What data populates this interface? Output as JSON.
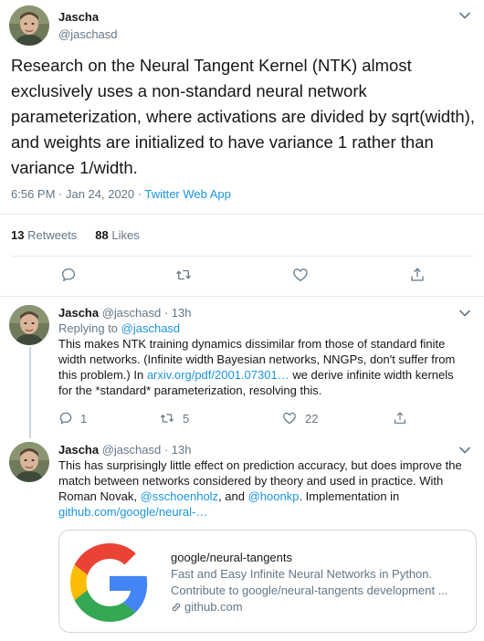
{
  "main_tweet": {
    "author_name": "Jascha",
    "author_handle": "@jaschasd",
    "text": "Research on the Neural Tangent Kernel (NTK) almost exclusively uses a non-standard neural network parameterization, where activations are divided by sqrt(width), and weights are initialized to have variance 1 rather than variance 1/width.",
    "timestamp": "6:56 PM · Jan 24, 2020 · ",
    "app": "Twitter Web App",
    "retweet_count": "13",
    "retweet_label": "Retweets",
    "like_count": "88",
    "like_label": "Likes"
  },
  "replies": [
    {
      "author_name": "Jascha",
      "author_handle": "@jaschasd",
      "time": "· 13h",
      "replying_prefix": "Replying to ",
      "replying_to": "@jaschasd",
      "text_part1": "This makes NTK training dynamics dissimilar from those of standard finite width networks. (Infinite width Bayesian networks, NNGPs, don't suffer from this problem.) In ",
      "link": "arxiv.org/pdf/2001.07301…",
      "text_part2": " we derive infinite width kernels for the *standard* parameterization, resolving this.",
      "reply_count": "1",
      "retweet_count": "5",
      "like_count": "22"
    },
    {
      "author_name": "Jascha",
      "author_handle": "@jaschasd",
      "time": "· 13h",
      "text_part1": "This has surprisingly little effect on prediction accuracy, but does improve the match between networks considered by theory and used in practice. With Roman Novak, ",
      "mention1": "@sschoenholz",
      "text_part2": ", and ",
      "mention2": "@hoonkp",
      "text_part3": ". Implementation in ",
      "link": "github.com/google/neural-…"
    }
  ],
  "link_card": {
    "title": "google/neural-tangents",
    "description_line1": "Fast and Easy Infinite Neural Networks in Python.",
    "description_line2": "Contribute to google/neural-tangents development ...",
    "domain": "github.com"
  },
  "colors": {
    "accent": "#1b95e0",
    "text": "#14171a",
    "secondary": "#657786",
    "divider": "#e6ecf0"
  },
  "icons": {
    "reply": "reply-icon",
    "retweet": "retweet-icon",
    "like": "heart-icon",
    "share": "share-icon",
    "more": "chevron-down-icon",
    "link": "link-icon",
    "logo": "google-g-logo"
  }
}
